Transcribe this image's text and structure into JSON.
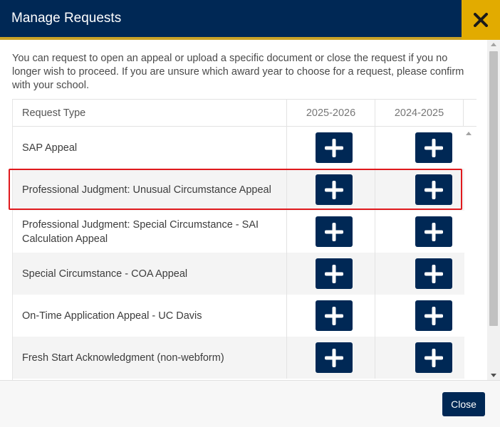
{
  "dialog": {
    "title": "Manage Requests",
    "close_icon": "close-x-icon",
    "close_button_label": "Close"
  },
  "intro_text": "You can request to open an appeal or upload a specific document or close the request if you no longer wish to proceed. If you are unsure which award year to choose for a request, please confirm with your school.",
  "table": {
    "headers": {
      "request_type": "Request Type",
      "year1": "2025-2026",
      "year2": "2024-2025"
    },
    "rows": [
      {
        "label": "SAP Appeal",
        "highlighted": false
      },
      {
        "label": "Professional Judgment: Unusual Circumstance Appeal",
        "highlighted": true
      },
      {
        "label": "Professional Judgment: Special Circumstance -  SAI Calculation Appeal",
        "highlighted": false
      },
      {
        "label": "Special Circumstance - COA Appeal",
        "highlighted": false
      },
      {
        "label": "On-Time Application Appeal - UC Davis",
        "highlighted": false
      },
      {
        "label": "Fresh Start Acknowledgment (non-webform)",
        "highlighted": false
      }
    ],
    "add_icon": "plus-icon"
  },
  "colors": {
    "header_bg": "#002855",
    "header_accent": "#c9a227",
    "close_bg": "#e2ab00",
    "button_bg": "#002855",
    "highlight_border": "#e0191d",
    "alt_row_bg": "#f4f4f4"
  }
}
